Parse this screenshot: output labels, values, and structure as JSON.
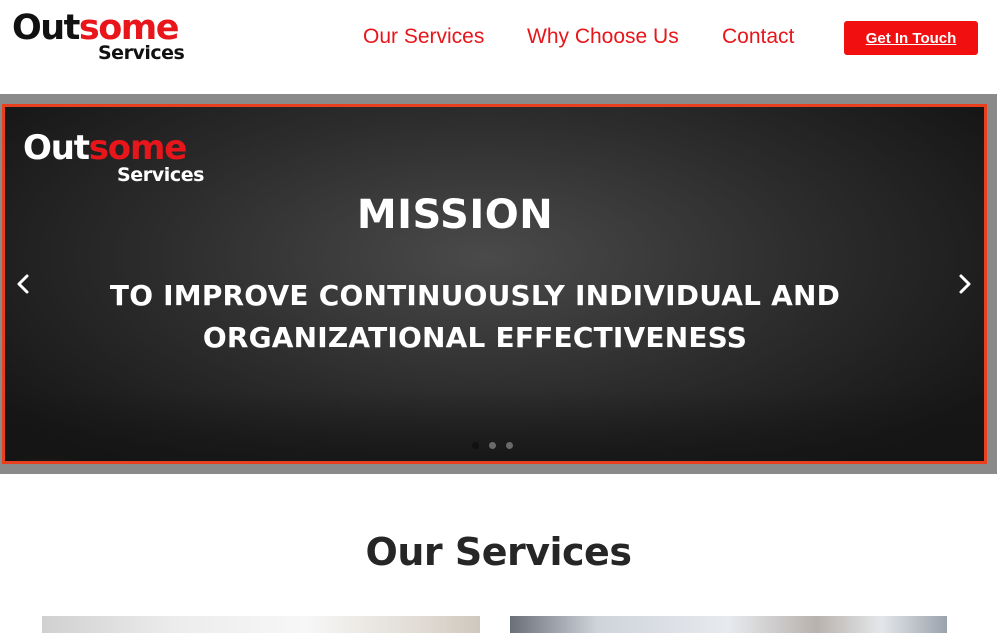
{
  "header": {
    "logo": {
      "word_black": "Out",
      "word_red": "some",
      "sub": "Services"
    },
    "nav": [
      {
        "label": "Our Services"
      },
      {
        "label": "Why Choose Us"
      },
      {
        "label": "Contact"
      }
    ],
    "cta_label": "Get In Touch"
  },
  "slider": {
    "logo": {
      "word_white": "Out",
      "word_red": "some",
      "sub": "Services"
    },
    "heading": "MISSION",
    "line1": "TO IMPROVE CONTINUOUSLY INDIVIDUAL AND",
    "line2": "ORGANIZATIONAL  EFFECTIVENESS",
    "prev_icon": "chevron-left-icon",
    "next_icon": "chevron-right-icon",
    "dots_count": 3,
    "active_dot": 1
  },
  "services": {
    "title": "Our Services"
  },
  "colors": {
    "brand_red": "#e8161a",
    "cta_bg": "#f20f0f",
    "slide_border": "#e8401e"
  }
}
